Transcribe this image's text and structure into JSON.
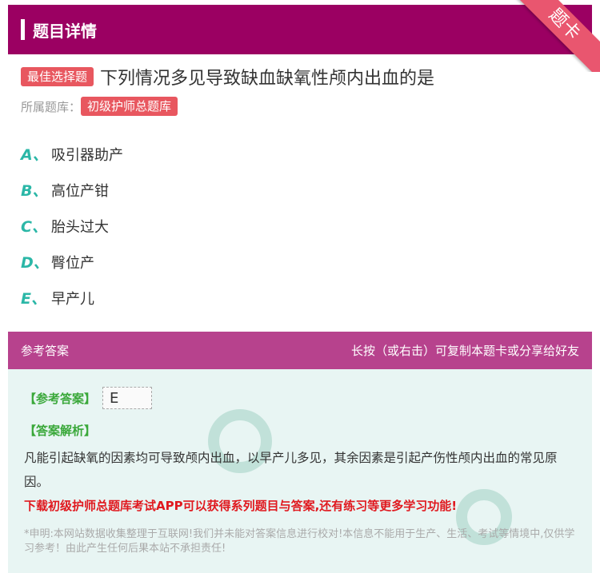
{
  "header": {
    "title": "题目详情"
  },
  "ribbon": {
    "label": "题卡"
  },
  "question": {
    "type_badge": "最佳选择题",
    "title": "下列情况多见导致缺血缺氧性颅内出血的是"
  },
  "bank": {
    "label": "所属题库：",
    "name": "初级护师总题库"
  },
  "options": [
    {
      "letter": "A、",
      "text": "吸引器助产"
    },
    {
      "letter": "B、",
      "text": "高位产钳"
    },
    {
      "letter": "C、",
      "text": "胎头过大"
    },
    {
      "letter": "D、",
      "text": "臀位产"
    },
    {
      "letter": "E、",
      "text": "早产儿"
    }
  ],
  "answer_section": {
    "title": "参考答案",
    "hint": "长按（或右击）可复制本题卡或分享给好友",
    "answer_label": "【参考答案】",
    "answer_value": "E",
    "analysis_label": "【答案解析】",
    "analysis_text": "凡能引起缺氧的因素均可导致颅内出血，以早产儿多见，其余因素是引起产伤性颅内出血的常见原因。",
    "promo": "下载初级护师总题库考试APP可以获得系列题目与答案,还有练习等更多学习功能!",
    "disclaimer": "*申明:本网站数据收集整理于互联网!我们并未能对答案信息进行校对!本信息不能用于生产、生活、考试等情境中,仅供学习参考！由此产生任何后果本站不承担责任!"
  },
  "colors": {
    "header_bg": "#9b0062",
    "answer_head_bg": "#b7428d",
    "accent_red": "#e8575f",
    "option_letter": "#2bb7a7",
    "promo_red": "#e0191f"
  }
}
